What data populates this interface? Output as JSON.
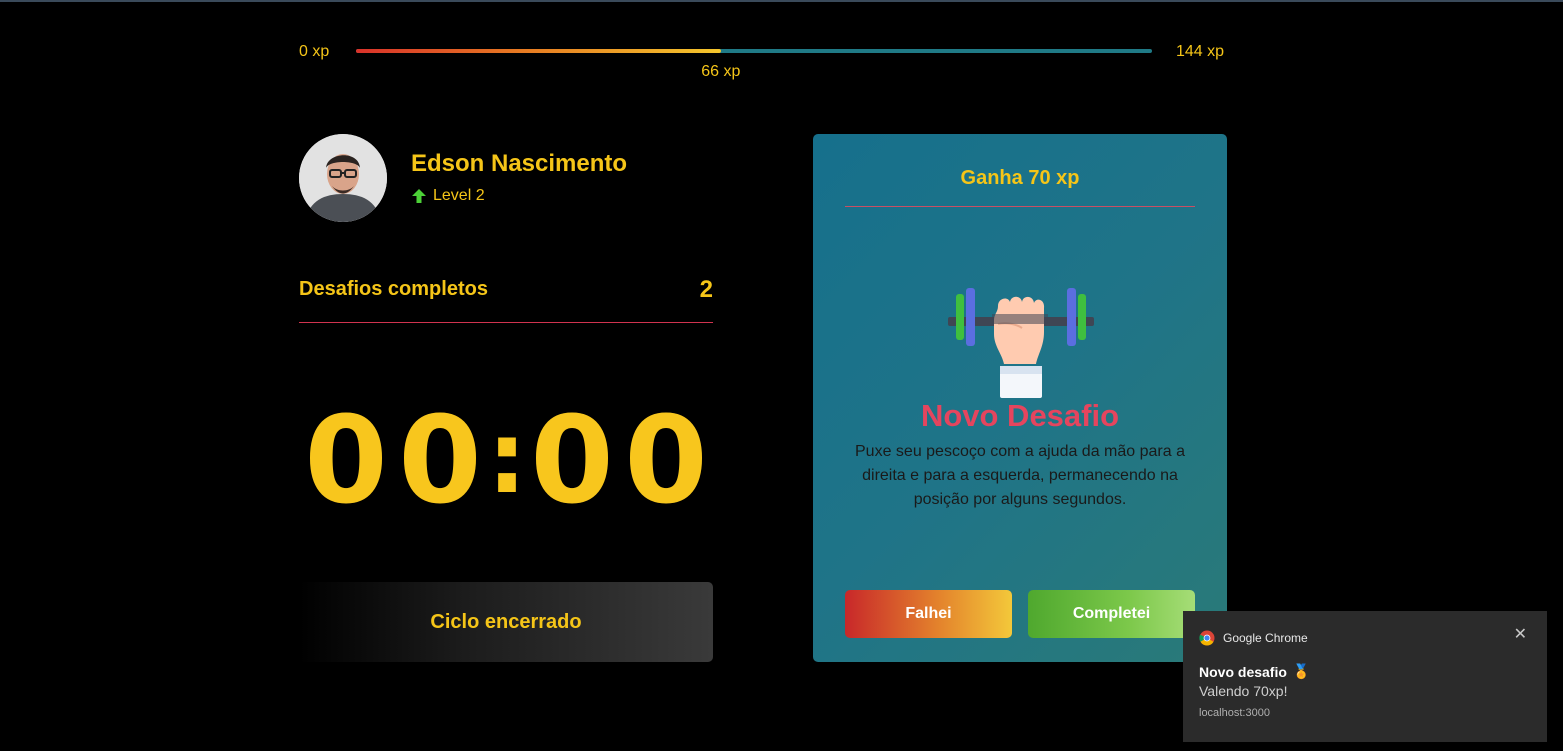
{
  "xp": {
    "min_label": "0 xp",
    "max_label": "144 xp",
    "current_label": "66 xp",
    "current": 66,
    "max": 144
  },
  "profile": {
    "name": "Edson Nascimento",
    "level_label": "Level 2"
  },
  "completed": {
    "label": "Desafios completos",
    "count": "2"
  },
  "countdown": {
    "digits": [
      "0",
      "0",
      "0",
      "0"
    ],
    "separator": ":"
  },
  "cycle_button": {
    "label": "Ciclo encerrado"
  },
  "challenge": {
    "header": "Ganha 70 xp",
    "title": "Novo Desafio",
    "description": "Puxe seu pescoço com a ajuda da mão para a direita e para a esquerda, permanecendo na posição por alguns segundos.",
    "fail_label": "Falhei",
    "complete_label": "Completei",
    "icon": "dumbbell-hand-icon"
  },
  "notification": {
    "app": "Google Chrome",
    "title": "Novo desafio",
    "title_emoji": "🏅",
    "body": "Valendo 70xp!",
    "source": "localhost:3000"
  },
  "colors": {
    "accent": "#f5c518",
    "danger": "#e5455e",
    "card": "#1f7488"
  }
}
